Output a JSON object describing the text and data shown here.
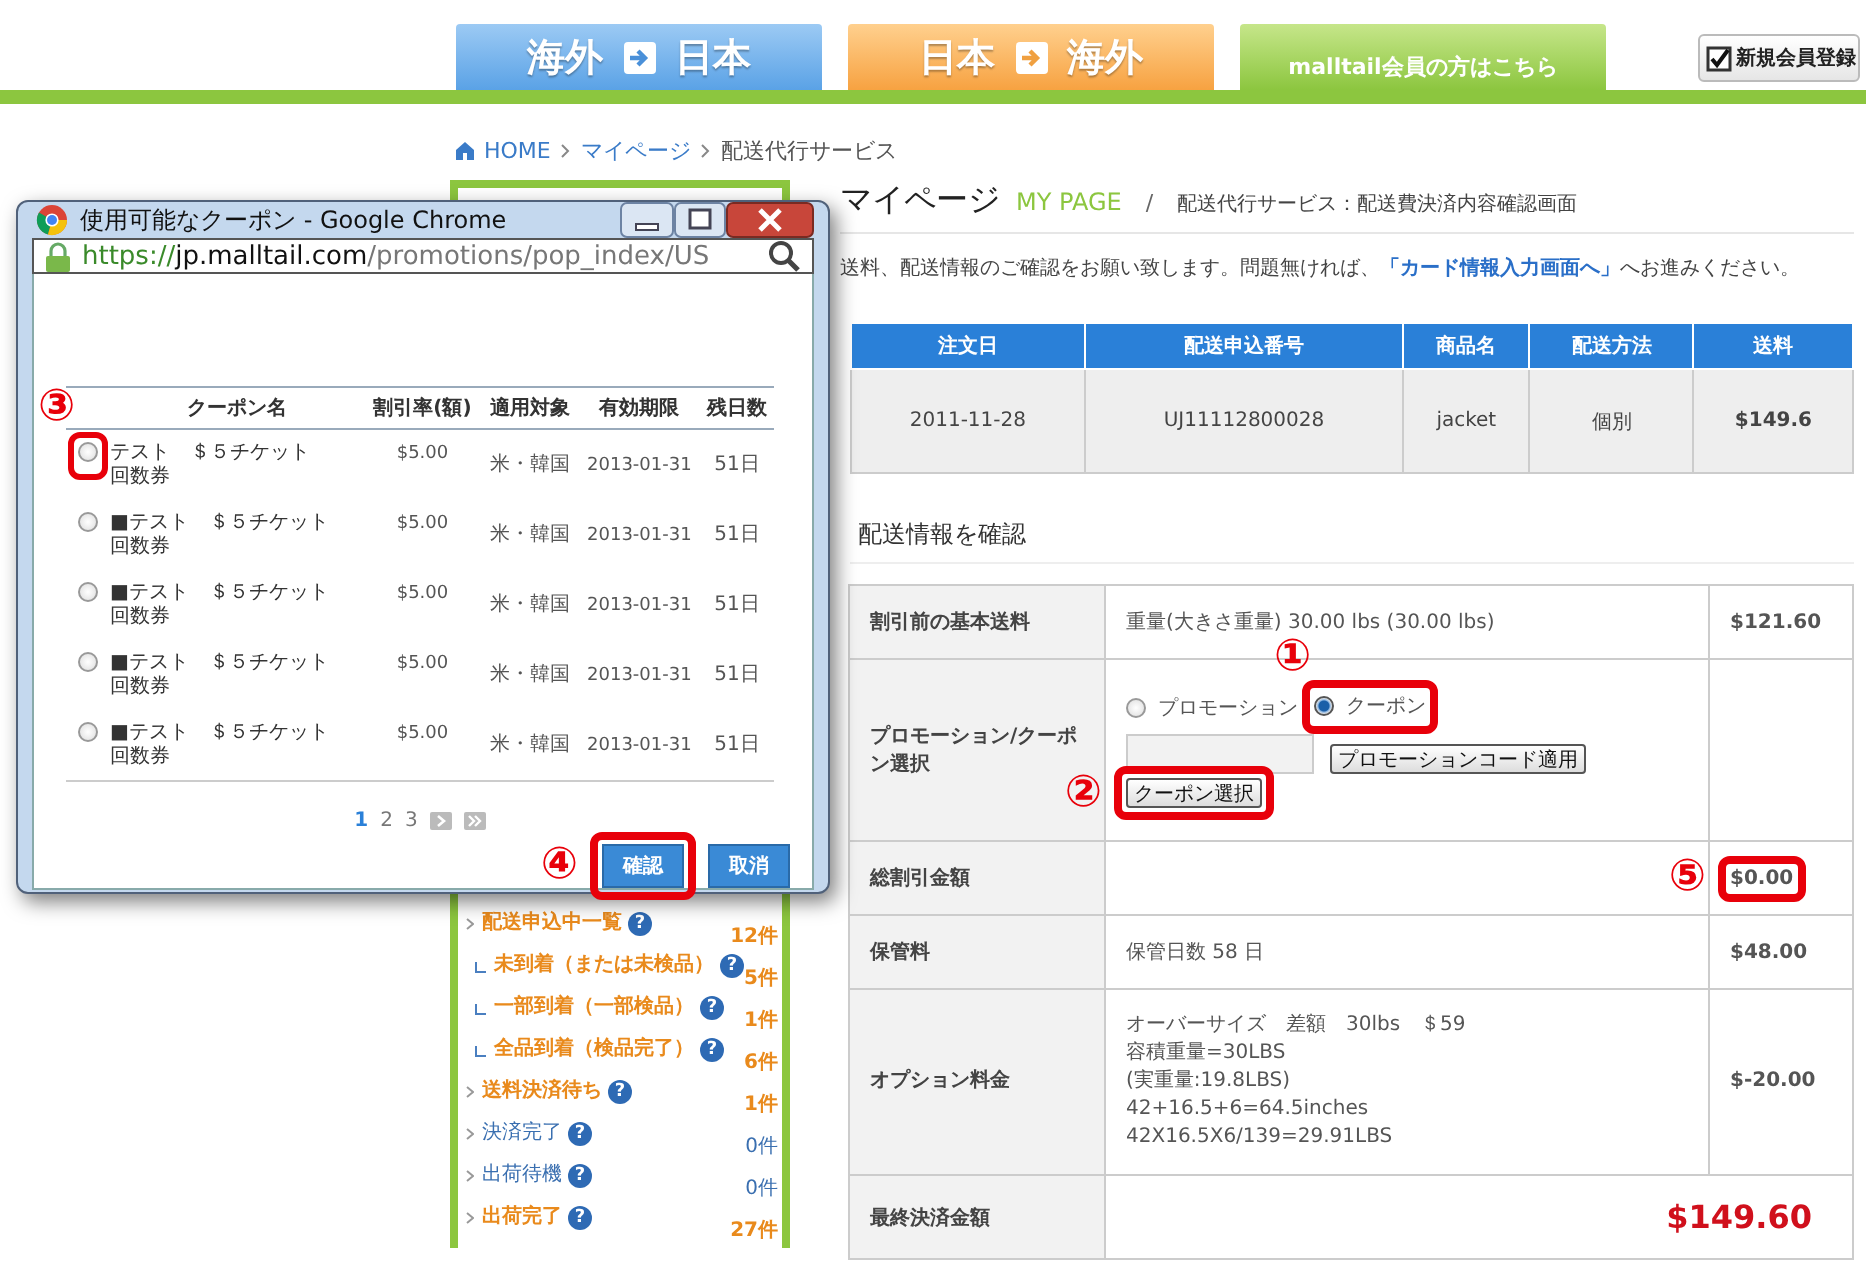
{
  "header": {
    "tabs": [
      {
        "kind": "inbound",
        "from": "海外",
        "to": "日本"
      },
      {
        "kind": "outbound",
        "from": "日本",
        "to": "海外"
      },
      {
        "kind": "member",
        "caption": "malltail会員の方はこちら"
      }
    ],
    "register_button": "新規会員登録"
  },
  "breadcrumb": [
    "HOME",
    "マイページ",
    "配送代行サービス"
  ],
  "page_title": {
    "title": "マイページ",
    "subtitle": "MY PAGE",
    "separator": "/",
    "section": "配送代行サービス：配送費決済内容確認画面"
  },
  "intro": {
    "before": "送料、配送情報のご確認をお願い致します。問題無ければ、",
    "link": "「カード情報入力画面へ」",
    "after": "へお進みください。"
  },
  "orders": {
    "columns": [
      "注文日",
      "配送申込番号",
      "商品名",
      "配送方法",
      "送料"
    ],
    "rows": [
      [
        "2011-11-28",
        "UJ11112800028",
        "jacket",
        "個別",
        "$149.6"
      ]
    ]
  },
  "shipping_heading": "配送情報を確認",
  "shipping_rows": [
    {
      "kind": "text",
      "label": "割引前の基本送料",
      "lines": [
        "重量(大きさ重量) 30.00 lbs (30.00 lbs)"
      ],
      "amount": "$121.60"
    },
    {
      "kind": "promo",
      "label": "プロモーション/クーポン選択",
      "options": [
        {
          "label": "プロモーション",
          "selected": false
        },
        {
          "label": "クーポン",
          "selected": true,
          "marker": {
            "kind": "top",
            "label": "①"
          }
        }
      ],
      "apply_button": "プロモーションコード適用",
      "coupon_button": {
        "label": "クーポン選択",
        "marker": {
          "kind": "left",
          "label": "②"
        }
      }
    },
    {
      "kind": "text",
      "label": "総割引金額",
      "amount": "$0.00",
      "marker": {
        "kind": "left",
        "label": "⑤"
      }
    },
    {
      "kind": "text",
      "label": "保管料",
      "lines": [
        "保管日数 58 日"
      ],
      "amount": "$48.00"
    },
    {
      "kind": "text",
      "label": "オプション料金",
      "lines": [
        "オーバーサイズ　差額　30lbs　＄59",
        "容積重量=30LBS",
        "(実重量:19.8LBS)",
        "42+16.5+6=64.5inches",
        "42X16.5X6/139=29.91LBS"
      ],
      "amount": "$-20.00"
    },
    {
      "kind": "final",
      "label": "最終決済金額",
      "amount": "$149.60"
    }
  ],
  "sidebar": {
    "items": [
      {
        "label": "配送申込中一覧",
        "help": "?",
        "count": "12件",
        "has_items": true,
        "children": [
          {
            "label": "未到着（または未検品）",
            "help": "?",
            "count": "5件",
            "has_items": true
          },
          {
            "label": "一部到着（一部検品）",
            "help": "?",
            "count": "1件",
            "has_items": true
          },
          {
            "label": "全品到着（検品完了）",
            "help": "?",
            "count": "6件",
            "has_items": true
          }
        ]
      },
      {
        "label": "送料決済待ち",
        "help": "?",
        "count": "1件",
        "has_items": true
      },
      {
        "label": "決済完了",
        "help": "?",
        "count": "0件",
        "has_items": false
      },
      {
        "label": "出荷待機",
        "help": "?",
        "count": "0件",
        "has_items": false
      },
      {
        "label": "出荷完了",
        "help": "?",
        "count": "27件",
        "has_items": true
      }
    ]
  },
  "popup": {
    "title": "使用可能なクーポン - Google Chrome",
    "url": {
      "scheme": "https://",
      "host": "jp.malltail.com",
      "path": "/promotions/pop_index/US"
    },
    "columns": [
      "クーポン名",
      "割引率(額)",
      "適用対象",
      "有効期限",
      "残日数"
    ],
    "rows": [
      {
        "selected": false,
        "name": "テスト　＄５チケット",
        "name_2": "回数券",
        "rate": "$5.00",
        "target": "米・韓国",
        "expires": "2013-01-31",
        "days": "51日",
        "marker": {
          "kind": "top",
          "label": "③"
        }
      },
      {
        "selected": false,
        "name": "■テスト　＄５チケット",
        "name_2": "回数券",
        "rate": "$5.00",
        "target": "米・韓国",
        "expires": "2013-01-31",
        "days": "51日"
      },
      {
        "selected": false,
        "name": "■テスト　＄５チケット",
        "name_2": "回数券",
        "rate": "$5.00",
        "target": "米・韓国",
        "expires": "2013-01-31",
        "days": "51日"
      },
      {
        "selected": false,
        "name": "■テスト　＄５チケット",
        "name_2": "回数券",
        "rate": "$5.00",
        "target": "米・韓国",
        "expires": "2013-01-31",
        "days": "51日"
      },
      {
        "selected": false,
        "name": "■テスト　＄５チケット",
        "name_2": "回数券",
        "rate": "$5.00",
        "target": "米・韓国",
        "expires": "2013-01-31",
        "days": "51日"
      }
    ],
    "pages": [
      {
        "label": "1",
        "selected": true
      },
      {
        "label": "2",
        "selected": false
      },
      {
        "label": "3",
        "selected": false
      }
    ],
    "buttons": [
      {
        "label": "確認",
        "marker": {
          "kind": "left",
          "label": "④"
        }
      },
      {
        "label": "取消"
      }
    ]
  }
}
